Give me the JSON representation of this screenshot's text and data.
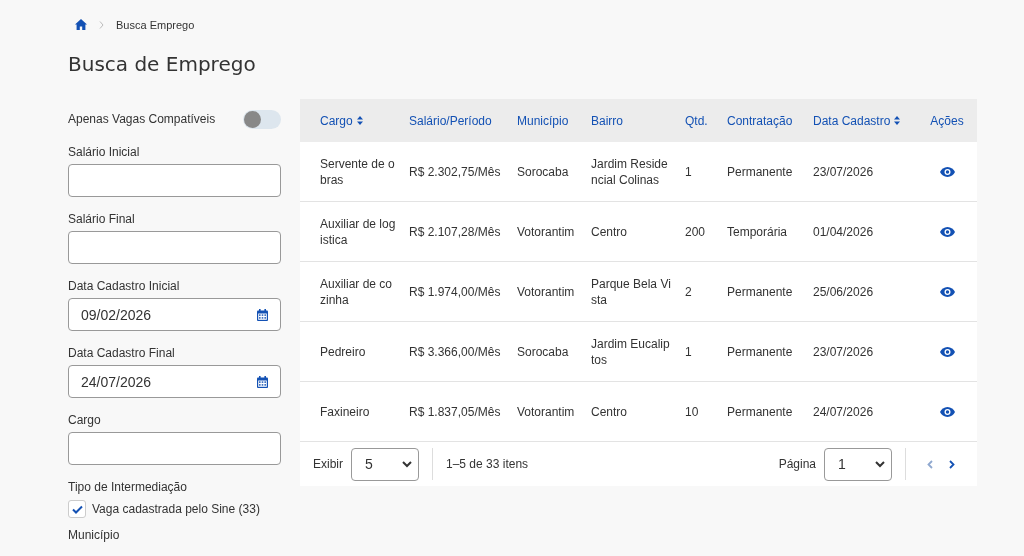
{
  "breadcrumb": {
    "current": "Busca Emprego"
  },
  "page_title": "Busca de Emprego",
  "filters": {
    "toggle": {
      "label": "Apenas Vagas Compatíveis",
      "on": false
    },
    "fields": [
      {
        "kind": "text",
        "label": "Salário Inicial"
      },
      {
        "kind": "text",
        "label": "Salário Final"
      },
      {
        "kind": "date",
        "label": "Data Cadastro Inicial",
        "value": "09/02/2026"
      },
      {
        "kind": "date",
        "label": "Data Cadastro Final",
        "value": "24/07/2026"
      },
      {
        "kind": "text",
        "label": "Cargo"
      }
    ],
    "intermediation": {
      "label": "Tipo de Intermediação",
      "options": [
        {
          "label": "Vaga cadastrada pelo Sine (33)",
          "checked": true
        }
      ]
    },
    "municipio_label": "Município"
  },
  "table": {
    "columns": [
      {
        "label": "Cargo",
        "sortable": true
      },
      {
        "label": "Salário/Período",
        "sortable": false
      },
      {
        "label": "Município",
        "sortable": false
      },
      {
        "label": "Bairro",
        "sortable": false
      },
      {
        "label": "Qtd.",
        "sortable": false
      },
      {
        "label": "Contratação",
        "sortable": false
      },
      {
        "label": "Data Cadastro",
        "sortable": true
      },
      {
        "label": "Ações",
        "sortable": false
      }
    ],
    "rows": [
      [
        "Servente de obras",
        "R$ 2.302,75/Mês",
        "Sorocaba",
        "Jardim Residencial Colinas",
        "1",
        "Permanente",
        "23/07/2026"
      ],
      [
        "Auxiliar de logistica",
        "R$ 2.107,28/Mês",
        "Votorantim",
        "Centro",
        "200",
        "Temporária",
        "01/04/2026"
      ],
      [
        "Auxiliar de cozinha",
        "R$ 1.974,00/Mês",
        "Votorantim",
        "Parque Bela Vista",
        "2",
        "Permanente",
        "25/06/2026"
      ],
      [
        "Pedreiro",
        "R$ 3.366,00/Mês",
        "Sorocaba",
        "Jardim Eucaliptos",
        "1",
        "Permanente",
        "23/07/2026"
      ],
      [
        "Faxineiro",
        "R$ 1.837,05/Mês",
        "Votorantim",
        "Centro",
        "10",
        "Permanente",
        "24/07/2026"
      ]
    ],
    "pagination": {
      "show_label": "Exibir",
      "page_size": "5",
      "range": "1–5 de 33 itens",
      "page_label": "Página",
      "page": "1",
      "prev_disabled": true,
      "next_disabled": false
    }
  }
}
